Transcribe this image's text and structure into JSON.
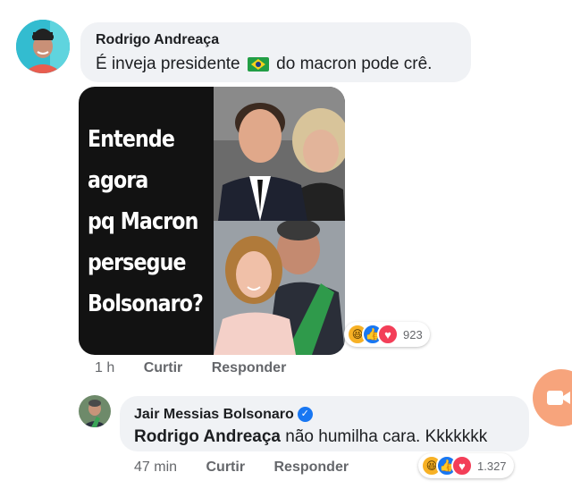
{
  "comment1": {
    "author": "Rodrigo Andreaça",
    "text_before": "É inveja presidente",
    "text_after": "do macron pode crê.",
    "meme_lines": [
      "Entende",
      "agora",
      "pq Macron",
      "persegue",
      "Bolsonaro?"
    ],
    "time": "1 h",
    "like_label": "Curtir",
    "reply_label": "Responder",
    "reaction_count": "923",
    "reactions": [
      "haha-icon",
      "like-icon",
      "love-icon"
    ]
  },
  "comment2": {
    "author": "Jair Messias Bolsonaro",
    "mention": "Rodrigo Andreaça",
    "text": "não humilha cara. Kkkkkkk",
    "time": "47 min",
    "like_label": "Curtir",
    "reply_label": "Responder",
    "reaction_count": "1.327",
    "reactions": [
      "haha-icon",
      "like-icon",
      "love-icon"
    ]
  },
  "colors": {
    "bubble": "#f0f2f5",
    "like": "#1877f2",
    "love": "#f33e58",
    "haha": "#f7b125",
    "verified": "#1877f2",
    "fab": "#f7a47c"
  }
}
